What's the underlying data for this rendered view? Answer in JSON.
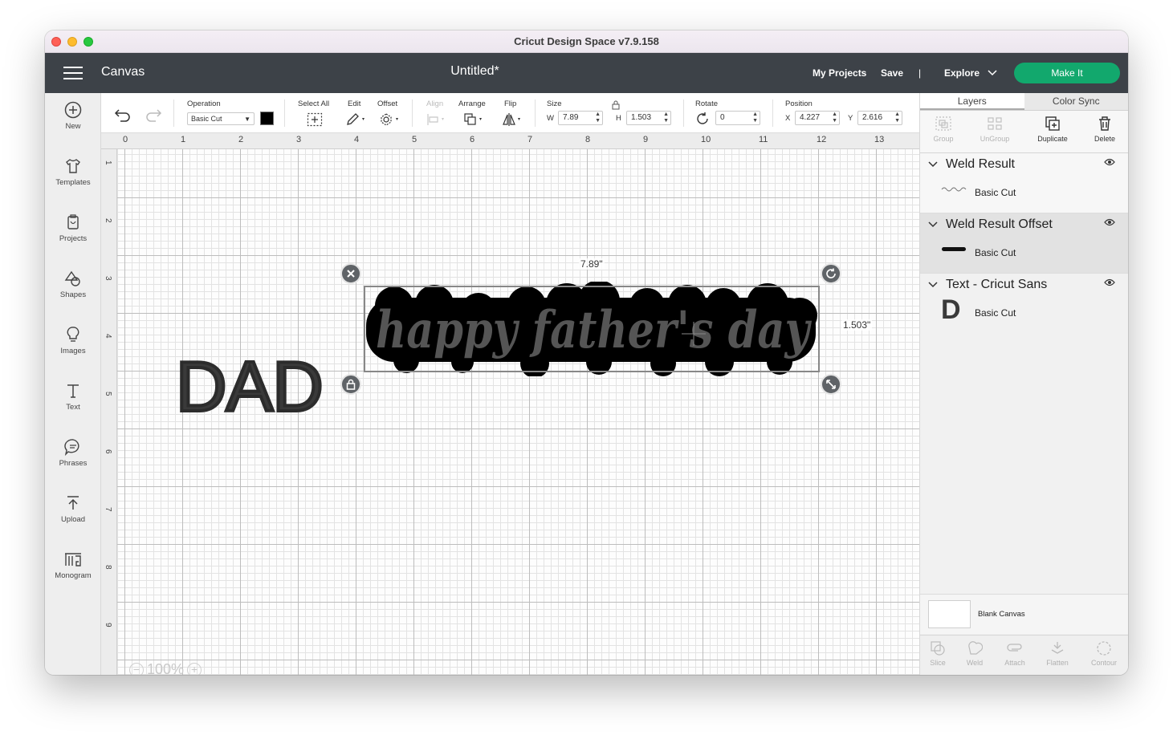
{
  "window": {
    "title": "Cricut Design Space  v7.9.158"
  },
  "appbar": {
    "section": "Canvas",
    "document_title": "Untitled*",
    "my_projects": "My Projects",
    "save": "Save",
    "separator": "|",
    "explore": "Explore",
    "make_it": "Make It"
  },
  "sidebar": {
    "items": [
      {
        "label": "New",
        "icon": "plus-circle-icon"
      },
      {
        "label": "Templates",
        "icon": "shirt-icon"
      },
      {
        "label": "Projects",
        "icon": "projects-icon"
      },
      {
        "label": "Shapes",
        "icon": "shapes-icon"
      },
      {
        "label": "Images",
        "icon": "bulb-icon"
      },
      {
        "label": "Text",
        "icon": "text-icon"
      },
      {
        "label": "Phrases",
        "icon": "chat-icon"
      },
      {
        "label": "Upload",
        "icon": "upload-icon"
      },
      {
        "label": "Monogram",
        "icon": "monogram-icon"
      }
    ]
  },
  "toolbar": {
    "operation_label": "Operation",
    "operation_value": "Basic Cut",
    "operation_color": "#000000",
    "select_all": "Select All",
    "edit": "Edit",
    "offset": "Offset",
    "align": "Align",
    "arrange": "Arrange",
    "flip": "Flip",
    "size": "Size",
    "w_label": "W",
    "w_value": "7.89",
    "h_label": "H",
    "h_value": "1.503",
    "rotate": "Rotate",
    "rotate_value": "0",
    "position": "Position",
    "x_label": "X",
    "x_value": "4.227",
    "y_label": "Y",
    "y_value": "2.616"
  },
  "canvas": {
    "ruler_top": [
      "0",
      "1",
      "2",
      "3",
      "4",
      "5",
      "6",
      "7",
      "8",
      "9",
      "10",
      "11",
      "12",
      "13"
    ],
    "ruler_left": [
      "1",
      "2",
      "3",
      "4",
      "5",
      "6",
      "7",
      "8",
      "9"
    ],
    "dad_text": "DAD",
    "phrase_text": "happy father's day",
    "width_label": "7.89\"",
    "height_label": "1.503\"",
    "zoom": "100%",
    "zoom_minus": "−",
    "zoom_plus": "+"
  },
  "panel": {
    "tabs": [
      "Layers",
      "Color Sync"
    ],
    "actions": [
      {
        "label": "Group",
        "enabled": false
      },
      {
        "label": "UnGroup",
        "enabled": false
      },
      {
        "label": "Duplicate",
        "enabled": true
      },
      {
        "label": "Delete",
        "enabled": true
      }
    ],
    "layers": [
      {
        "title": "Weld Result",
        "sub": "Basic Cut"
      },
      {
        "title": "Weld Result Offset",
        "sub": "Basic Cut"
      },
      {
        "title": "Text - Cricut Sans",
        "sub": "Basic Cut",
        "thumb": "D"
      }
    ],
    "blank_canvas": "Blank Canvas",
    "bottom_actions": [
      "Slice",
      "Weld",
      "Attach",
      "Flatten",
      "Contour"
    ]
  }
}
